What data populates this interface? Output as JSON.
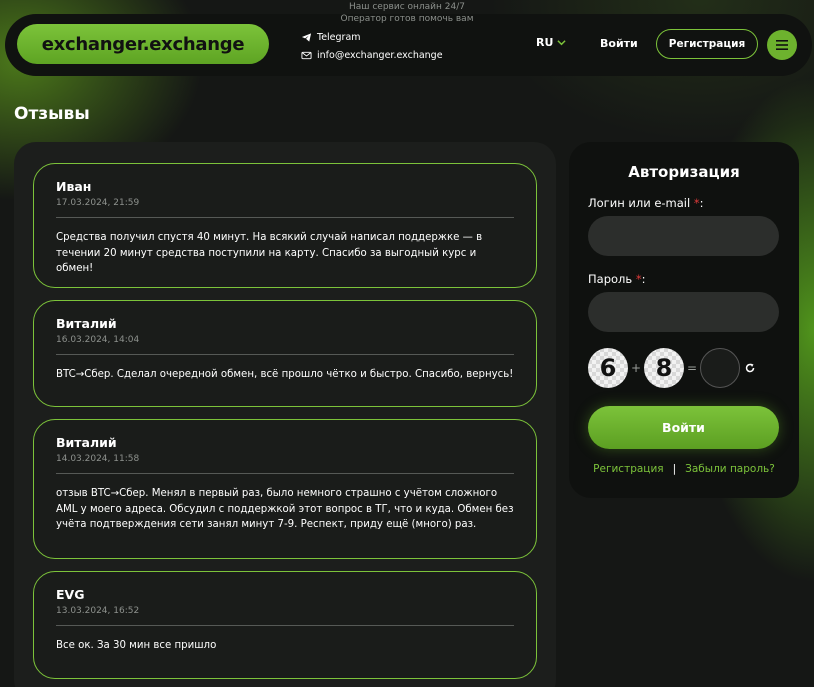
{
  "top_note": {
    "line1": "Наш сервис онлайн 24/7",
    "line2": "Оператор готов помочь вам"
  },
  "header": {
    "logo_text": "exchanger.exchange",
    "telegram_label": "Telegram",
    "email_label": "info@exchanger.exchange",
    "lang": "RU",
    "login_label": "Войти",
    "register_label": "Регистрация",
    "icons": [
      "telegram-icon",
      "mail-icon",
      "chevron-down-icon",
      "menu-icon"
    ]
  },
  "page_title": "Отзывы",
  "reviews": [
    {
      "name": "Иван",
      "date": "17.03.2024, 21:59",
      "text": "Средства получил спустя 40 минут. На всякий случай написал поддержке — в течении 20 минут средства поступили на карту. Спасибо за выгодный курс и обмен!"
    },
    {
      "name": "Виталий",
      "date": "16.03.2024, 14:04",
      "text": "BTC→Сбер. Сделал очередной обмен, всё прошло чётко и быстро. Спасибо, вернусь!"
    },
    {
      "name": "Виталий",
      "date": "14.03.2024, 11:58",
      "text": "отзыв BTC→Сбер. Менял в первый раз, было немного страшно с учётом сложного AML у моего адреса. Обсудил с поддержкой этот вопрос в ТГ, что и куда. Обмен без учёта подтверждения сети занял минут 7-9. Респект, приду ещё (много) раз."
    },
    {
      "name": "EVG",
      "date": "13.03.2024, 16:52",
      "text": "Все ок. За 30 мин все пришло"
    }
  ],
  "auth": {
    "title": "Авторизация",
    "login_label": "Логин или e-mail",
    "password_label": "Пароль",
    "required_mark": "*",
    "colon": ":",
    "captcha": {
      "a": "6",
      "op": "+",
      "b": "8",
      "eq": "="
    },
    "submit_label": "Войти",
    "register_link": "Регистрация",
    "separator": "|",
    "forgot_link": "Забыли пароль?"
  },
  "colors": {
    "accent": "#7cc33a",
    "background": "#151715",
    "panel": "#1c1e1c",
    "required": "#e23b3b"
  }
}
